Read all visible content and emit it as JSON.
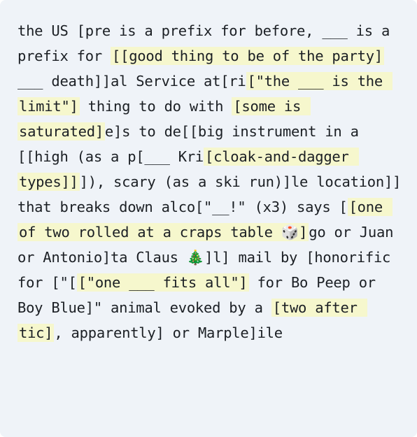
{
  "puzzle": {
    "segments": [
      {
        "text": "the US [pre is a prefix for before, ___ is a prefix for ",
        "highlight": false
      },
      {
        "text": "[[good thing to be of the party]",
        "highlight": true
      },
      {
        "text": " ___ death]]al Service at[ri",
        "highlight": false
      },
      {
        "text": "[\"the ___ is the limit\"]",
        "highlight": true
      },
      {
        "text": " thing to do with ",
        "highlight": false
      },
      {
        "text": "[some is saturated]",
        "highlight": true
      },
      {
        "text": "e]s to de[[big instrument in a [[high (as a p[___ Kri",
        "highlight": false
      },
      {
        "text": "[cloak-and-dagger types]]",
        "highlight": true
      },
      {
        "text": "]), scary (as a ski run)]le location]] that breaks down alco[\"__!\" (x3) says [",
        "highlight": false
      },
      {
        "text": "[one of two rolled at a craps table 🎲]",
        "highlight": true
      },
      {
        "text": "go or Juan or Antonio]ta Claus 🎄]l] mail by [honorific for [\"[",
        "highlight": false
      },
      {
        "text": "[\"one ___ fits all\"]",
        "highlight": true
      },
      {
        "text": " for Bo Peep or Boy Blue]\" animal evoked by a ",
        "highlight": false
      },
      {
        "text": "[two after tic]",
        "highlight": true
      },
      {
        "text": ", apparently] or Marple]ile",
        "highlight": false
      }
    ]
  },
  "colors": {
    "background": "#eff3f8",
    "highlight": "#f6f7cd",
    "text": "#1b1f24"
  }
}
